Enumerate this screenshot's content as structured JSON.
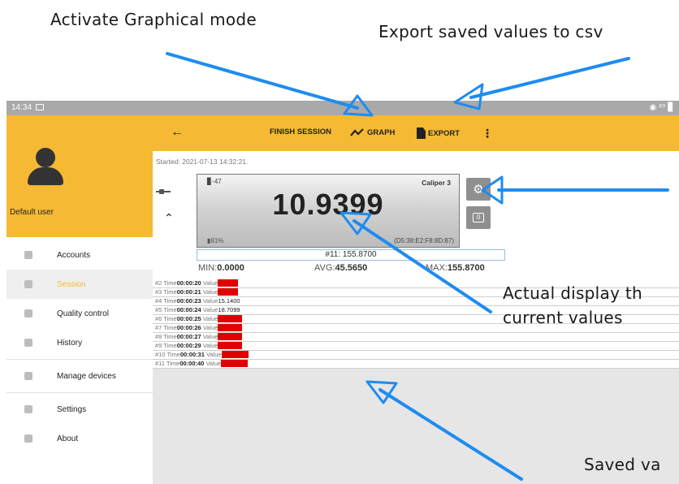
{
  "annotations": {
    "graph_caption": "Activate Graphical mode",
    "export_caption": "Export saved values to csv",
    "display_caption_line1": "Actual display th",
    "display_caption_line2": "current values",
    "saved_caption": "Saved va"
  },
  "statusbar": {
    "time": "14:34",
    "right": "◉ ⁸⁹ ▊"
  },
  "sidebar": {
    "user_name": "Default user",
    "items": [
      {
        "label": "Accounts",
        "icon": "account-icon"
      },
      {
        "label": "Session",
        "icon": "session-icon",
        "active": true
      },
      {
        "label": "Quality control",
        "icon": "quality-icon"
      },
      {
        "label": "History",
        "icon": "history-icon"
      },
      {
        "label": "Manage devices",
        "icon": "device-icon"
      },
      {
        "label": "Settings",
        "icon": "settings-icon"
      },
      {
        "label": "About",
        "icon": "info-icon"
      }
    ]
  },
  "toolbar": {
    "finish_label": "FINISH SESSION",
    "graph_label": "GRAPH",
    "export_label": "EXPORT",
    "colors": {
      "accent": "#f6b934",
      "alarm": "#e00000"
    }
  },
  "session": {
    "started": "Started: 2021-07-13 14:32:21.",
    "device_signal": "-47",
    "device_name": "Caliper 3",
    "current_value": "10.9399",
    "battery": "81%",
    "device_address": "D5:38:E2:F8:8D:87",
    "last_reading": "#11: 155.8700",
    "min_label": "MIN:",
    "min_value": "0.0000",
    "avg_label": "AVG:",
    "avg_value": "45.5650",
    "max_label": "MAX:",
    "max_value": "155.8700"
  },
  "readings": [
    {
      "num": "#2",
      "time": "00:00:20",
      "value": "6.2900",
      "alarm": true
    },
    {
      "num": "#3",
      "time": "00:00:21",
      "value": "4.8100",
      "alarm": true
    },
    {
      "num": "#4",
      "time": "00:00:23",
      "value": "15.1400",
      "alarm": false
    },
    {
      "num": "#5",
      "time": "00:00:24",
      "value": "18.7099",
      "alarm": false
    },
    {
      "num": "#6",
      "time": "00:00:25",
      "value": "27.3600",
      "alarm": true
    },
    {
      "num": "#7",
      "time": "00:00:26",
      "value": "35.1500",
      "alarm": true
    },
    {
      "num": "#8",
      "time": "00:00:27",
      "value": "61.8600",
      "alarm": true
    },
    {
      "num": "#9",
      "time": "00:00:29",
      "value": "79.5700",
      "alarm": true
    },
    {
      "num": "#10",
      "time": "00:00:31",
      "value": "152.8600",
      "alarm": true
    },
    {
      "num": "#11",
      "time": "00:00:40",
      "value": "155.8700",
      "alarm": true
    }
  ],
  "reading_labels": {
    "time": "Time",
    "value": "Value"
  }
}
